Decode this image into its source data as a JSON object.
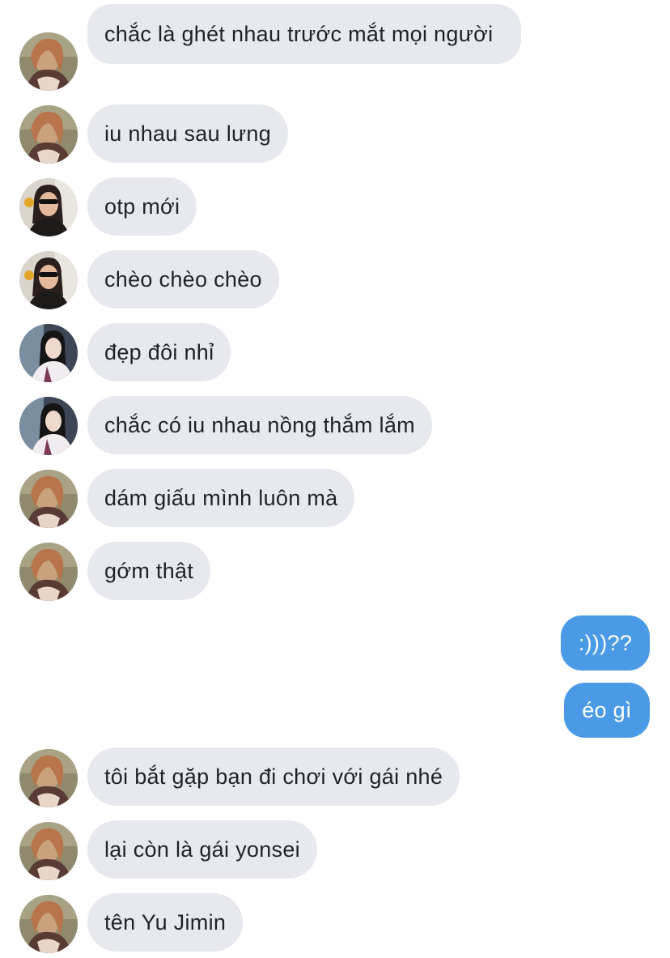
{
  "messages": [
    {
      "side": "in",
      "avatar": "user-a",
      "text": "chắc là ghét nhau trước mắt mọi người"
    },
    {
      "side": "in",
      "avatar": "user-a",
      "text": "iu nhau sau lưng"
    },
    {
      "side": "in",
      "avatar": "user-b",
      "text": "otp mới"
    },
    {
      "side": "in",
      "avatar": "user-b",
      "text": "chèo chèo chèo"
    },
    {
      "side": "in",
      "avatar": "user-c",
      "text": "đẹp đôi nhỉ"
    },
    {
      "side": "in",
      "avatar": "user-c",
      "text": "chắc có iu nhau nồng thắm lắm"
    },
    {
      "side": "in",
      "avatar": "user-a",
      "text": "dám giấu mình luôn mà"
    },
    {
      "side": "in",
      "avatar": "user-a",
      "text": "gớm thật"
    },
    {
      "side": "out",
      "text": ":)))??"
    },
    {
      "side": "out",
      "text": "éo gì"
    },
    {
      "side": "in",
      "avatar": "user-a",
      "text": "tôi bắt gặp bạn đi chơi với gái nhé"
    },
    {
      "side": "in",
      "avatar": "user-a",
      "text": "lại còn là gái yonsei"
    },
    {
      "side": "in",
      "avatar": "user-a",
      "text": "tên Yu Jimin"
    }
  ],
  "colors": {
    "incoming_bubble": "#e7e9ee",
    "incoming_text": "#1f2328",
    "outgoing_bubble": "#4a9ae6",
    "outgoing_text": "#ffffff"
  }
}
